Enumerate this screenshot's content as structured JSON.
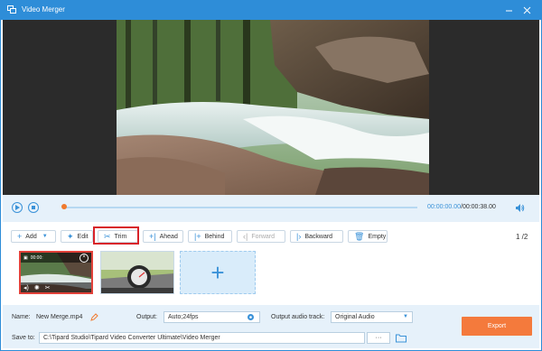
{
  "window": {
    "title": "Video Merger",
    "accent": "#2e8dd8"
  },
  "player": {
    "current_time": "00:00:00.00",
    "separator": "/",
    "total_time": "00:00:38.00"
  },
  "toolbar": {
    "add_label": "Add",
    "edit_label": "Edit",
    "trim_label": "Trim",
    "ahead_label": "Ahead",
    "behind_label": "Behind",
    "forward_label": "Forward",
    "backward_label": "Backward",
    "empty_label": "Empty",
    "page_indicator": "1 /2"
  },
  "clips": [
    {
      "time": "00:00:",
      "icons": [
        "film-icon",
        "close-icon",
        "volume-icon",
        "effect-icon",
        "scissors-icon"
      ]
    },
    {
      "icons": [
        "speedometer"
      ]
    }
  ],
  "settings": {
    "name_label": "Name:",
    "name_value": "New Merge.mp4",
    "output_label": "Output:",
    "output_value": "Auto;24fps",
    "audio_label": "Output audio track:",
    "audio_value": "Original Audio",
    "save_label": "Save to:",
    "save_path": "C:\\Tipard Studio\\Tipard Video Converter Ultimate\\Video Merger",
    "browse_label": "···",
    "export_label": "Export"
  },
  "colors": {
    "highlight": "#d8232a",
    "export": "#f47a3c",
    "progress_dot": "#f07a2d"
  }
}
